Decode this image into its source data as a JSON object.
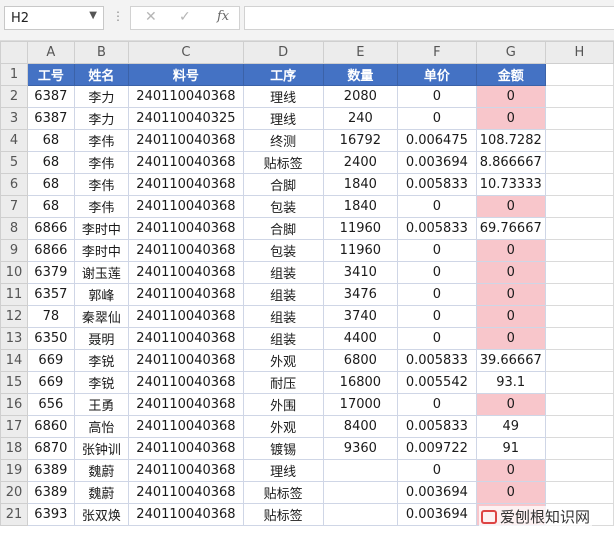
{
  "formula_bar": {
    "name_box": "H2",
    "name_dropdown": "▼",
    "dots": "⋮",
    "cancel_glyph": "✕",
    "confirm_glyph": "✓",
    "fx_label": "fx",
    "formula": ""
  },
  "grid": {
    "columns": [
      "A",
      "B",
      "C",
      "D",
      "E",
      "F",
      "G",
      "H"
    ],
    "header_row_number": "1",
    "header": [
      "工号",
      "姓名",
      "料号",
      "工序",
      "数量",
      "单价",
      "金额"
    ],
    "rows": [
      {
        "n": "2",
        "a": "6387",
        "b": "李力",
        "c": "240110040368",
        "d": "理线",
        "e": "2080",
        "f": "0",
        "g": "0",
        "pink": true
      },
      {
        "n": "3",
        "a": "6387",
        "b": "李力",
        "c": "240110040325",
        "d": "理线",
        "e": "240",
        "f": "0",
        "g": "0",
        "pink": true
      },
      {
        "n": "4",
        "a": "68",
        "b": "李伟",
        "c": "240110040368",
        "d": "终测",
        "e": "16792",
        "f": "0.006475",
        "g": "108.7282",
        "pink": false
      },
      {
        "n": "5",
        "a": "68",
        "b": "李伟",
        "c": "240110040368",
        "d": "贴标签",
        "e": "2400",
        "f": "0.003694",
        "g": "8.866667",
        "pink": false
      },
      {
        "n": "6",
        "a": "68",
        "b": "李伟",
        "c": "240110040368",
        "d": "合脚",
        "e": "1840",
        "f": "0.005833",
        "g": "10.73333",
        "pink": false
      },
      {
        "n": "7",
        "a": "68",
        "b": "李伟",
        "c": "240110040368",
        "d": "包装",
        "e": "1840",
        "f": "0",
        "g": "0",
        "pink": true
      },
      {
        "n": "8",
        "a": "6866",
        "b": "李时中",
        "c": "240110040368",
        "d": "合脚",
        "e": "11960",
        "f": "0.005833",
        "g": "69.76667",
        "pink": false
      },
      {
        "n": "9",
        "a": "6866",
        "b": "李时中",
        "c": "240110040368",
        "d": "包装",
        "e": "11960",
        "f": "0",
        "g": "0",
        "pink": true
      },
      {
        "n": "10",
        "a": "6379",
        "b": "谢玉莲",
        "c": "240110040368",
        "d": "组装",
        "e": "3410",
        "f": "0",
        "g": "0",
        "pink": true
      },
      {
        "n": "11",
        "a": "6357",
        "b": "郭峰",
        "c": "240110040368",
        "d": "组装",
        "e": "3476",
        "f": "0",
        "g": "0",
        "pink": true
      },
      {
        "n": "12",
        "a": "78",
        "b": "秦翠仙",
        "c": "240110040368",
        "d": "组装",
        "e": "3740",
        "f": "0",
        "g": "0",
        "pink": true
      },
      {
        "n": "13",
        "a": "6350",
        "b": "聂明",
        "c": "240110040368",
        "d": "组装",
        "e": "4400",
        "f": "0",
        "g": "0",
        "pink": true
      },
      {
        "n": "14",
        "a": "669",
        "b": "李锐",
        "c": "240110040368",
        "d": "外观",
        "e": "6800",
        "f": "0.005833",
        "g": "39.66667",
        "pink": false
      },
      {
        "n": "15",
        "a": "669",
        "b": "李锐",
        "c": "240110040368",
        "d": "耐压",
        "e": "16800",
        "f": "0.005542",
        "g": "93.1",
        "pink": false
      },
      {
        "n": "16",
        "a": "656",
        "b": "王勇",
        "c": "240110040368",
        "d": "外围",
        "e": "17000",
        "f": "0",
        "g": "0",
        "pink": true
      },
      {
        "n": "17",
        "a": "6860",
        "b": "高怡",
        "c": "240110040368",
        "d": "外观",
        "e": "8400",
        "f": "0.005833",
        "g": "49",
        "pink": false
      },
      {
        "n": "18",
        "a": "6870",
        "b": "张钟训",
        "c": "240110040368",
        "d": "镀锡",
        "e": "9360",
        "f": "0.009722",
        "g": "91",
        "pink": false
      },
      {
        "n": "19",
        "a": "6389",
        "b": "魏蔚",
        "c": "240110040368",
        "d": "理线",
        "e": "",
        "f": "0",
        "g": "0",
        "pink": true
      },
      {
        "n": "20",
        "a": "6389",
        "b": "魏蔚",
        "c": "240110040368",
        "d": "贴标签",
        "e": "",
        "f": "0.003694",
        "g": "0",
        "pink": true
      },
      {
        "n": "21",
        "a": "6393",
        "b": "张双焕",
        "c": "240110040368",
        "d": "贴标签",
        "e": "",
        "f": "0.003694",
        "g": "",
        "pink": true
      }
    ]
  },
  "watermark": "爱刨根知识网",
  "colors": {
    "header_fill": "#4472c4",
    "header_text": "#ffffff",
    "pink_fill": "#f8c6cb",
    "sheet_header": "#ececec"
  }
}
